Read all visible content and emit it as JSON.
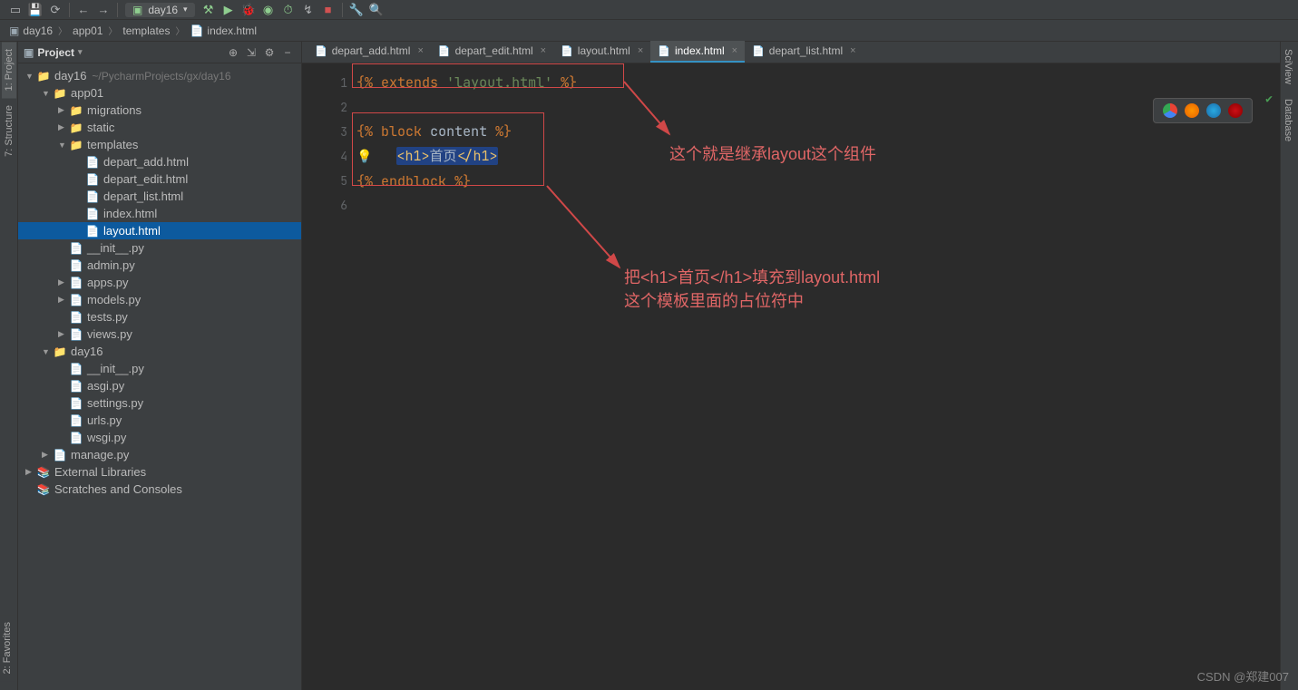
{
  "toolbar": {
    "run_config": "day16"
  },
  "breadcrumb": [
    "day16",
    "app01",
    "templates",
    "index.html"
  ],
  "project": {
    "label": "Project",
    "root": {
      "name": "day16",
      "path": "~/PycharmProjects/gx/day16"
    },
    "tree": [
      {
        "depth": 0,
        "arrow": "▼",
        "icon": "folder",
        "label": "day16",
        "path": "~/PycharmProjects/gx/day16"
      },
      {
        "depth": 1,
        "arrow": "▼",
        "icon": "folder",
        "label": "app01"
      },
      {
        "depth": 2,
        "arrow": "▶",
        "icon": "folder",
        "label": "migrations"
      },
      {
        "depth": 2,
        "arrow": "▶",
        "icon": "folder",
        "label": "static"
      },
      {
        "depth": 2,
        "arrow": "▼",
        "icon": "folder",
        "label": "templates"
      },
      {
        "depth": 3,
        "arrow": " ",
        "icon": "html",
        "label": "depart_add.html"
      },
      {
        "depth": 3,
        "arrow": " ",
        "icon": "html",
        "label": "depart_edit.html"
      },
      {
        "depth": 3,
        "arrow": " ",
        "icon": "html",
        "label": "depart_list.html"
      },
      {
        "depth": 3,
        "arrow": " ",
        "icon": "html",
        "label": "index.html"
      },
      {
        "depth": 3,
        "arrow": " ",
        "icon": "html",
        "label": "layout.html",
        "selected": true
      },
      {
        "depth": 2,
        "arrow": " ",
        "icon": "py",
        "label": "__init__.py"
      },
      {
        "depth": 2,
        "arrow": " ",
        "icon": "py",
        "label": "admin.py"
      },
      {
        "depth": 2,
        "arrow": "▶",
        "icon": "py",
        "label": "apps.py"
      },
      {
        "depth": 2,
        "arrow": "▶",
        "icon": "py",
        "label": "models.py"
      },
      {
        "depth": 2,
        "arrow": " ",
        "icon": "py",
        "label": "tests.py"
      },
      {
        "depth": 2,
        "arrow": "▶",
        "icon": "py",
        "label": "views.py"
      },
      {
        "depth": 1,
        "arrow": "▼",
        "icon": "folder",
        "label": "day16"
      },
      {
        "depth": 2,
        "arrow": " ",
        "icon": "py",
        "label": "__init__.py"
      },
      {
        "depth": 2,
        "arrow": " ",
        "icon": "py",
        "label": "asgi.py"
      },
      {
        "depth": 2,
        "arrow": " ",
        "icon": "py",
        "label": "settings.py"
      },
      {
        "depth": 2,
        "arrow": " ",
        "icon": "py",
        "label": "urls.py"
      },
      {
        "depth": 2,
        "arrow": " ",
        "icon": "py",
        "label": "wsgi.py"
      },
      {
        "depth": 1,
        "arrow": "▶",
        "icon": "py",
        "label": "manage.py"
      },
      {
        "depth": 0,
        "arrow": "▶",
        "icon": "mod",
        "label": "External Libraries"
      },
      {
        "depth": 0,
        "arrow": " ",
        "icon": "mod",
        "label": "Scratches and Consoles"
      }
    ]
  },
  "tabs": [
    {
      "label": "depart_add.html"
    },
    {
      "label": "depart_edit.html"
    },
    {
      "label": "layout.html"
    },
    {
      "label": "index.html",
      "active": true
    },
    {
      "label": "depart_list.html"
    }
  ],
  "code": {
    "lines": [
      "1",
      "2",
      "3",
      "4",
      "5",
      "6"
    ],
    "l1": {
      "open": "{%",
      "kw": "extends",
      "str": "'layout.html'",
      "close": "%}"
    },
    "l3": {
      "open": "{%",
      "kw": "block",
      "name": "content",
      "close": "%}"
    },
    "l4": {
      "tag_open": "<h1>",
      "text": "首页",
      "tag_close": "</h1>"
    },
    "l5": {
      "open": "{%",
      "kw": "endblock",
      "close": "%}"
    }
  },
  "annotations": {
    "a1": "这个就是继承layout这个组件",
    "a2_line1": "把<h1>首页</h1>填充到layout.html",
    "a2_line2": "这个模板里面的占位符中"
  },
  "sidetabs": {
    "project": "1: Project",
    "structure": "7: Structure",
    "favorites": "2: Favorites",
    "sciview": "SciView",
    "database": "Database"
  },
  "watermark": "CSDN @郑建007"
}
